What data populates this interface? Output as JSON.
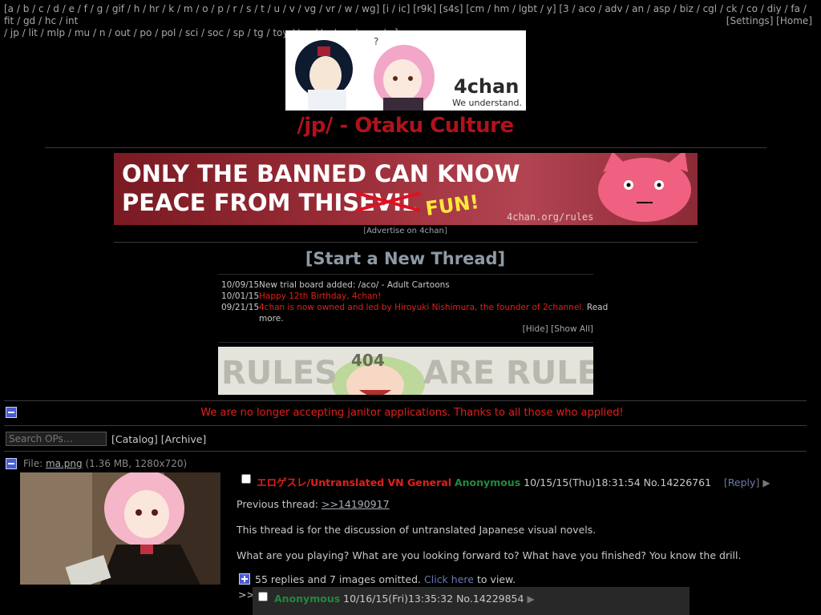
{
  "nav": {
    "left_line1": [
      "[a",
      "b",
      "c",
      "d",
      "e",
      "f",
      "g",
      "gif",
      "h",
      "hr",
      "k",
      "m",
      "o",
      "p",
      "r",
      "s",
      "t",
      "u",
      "v",
      "vg",
      "vr",
      "w",
      "wg] [i",
      "ic] [r9k] [s4s] [cm",
      "hm",
      "lgbt",
      "y] [3",
      "aco",
      "adv",
      "an",
      "asp",
      "biz",
      "cgl",
      "ck",
      "co",
      "diy",
      "fa",
      "fit",
      "gd",
      "hc",
      "int"
    ],
    "left_line2": [
      "jp",
      "lit",
      "mlp",
      "mu",
      "n",
      "out",
      "po",
      "pol",
      "sci",
      "soc",
      "sp",
      "tg",
      "toy",
      "trv",
      "tv",
      "vp",
      "wsg",
      "x]"
    ],
    "line2_prefix": "/",
    "settings": "Settings",
    "home": "Home"
  },
  "banner": {
    "logo_text": "4chan",
    "logo_sub": "We understand.",
    "question": "?"
  },
  "board_title": "/jp/ - Otaku Culture",
  "ad": {
    "line1": "ONLY THE BANNED CAN KNOW",
    "line2": "PEACE FROM THIS",
    "struck": "EVIL",
    "fun": "FUN!",
    "url": "4chan.org/rules",
    "link_text": "Advertise on 4chan"
  },
  "start_thread": "[Start a New Thread]",
  "news": [
    {
      "date": "10/09/15",
      "text": "New trial board added: /aco/ - Adult Cartoons",
      "color": "#c8c8c8"
    },
    {
      "date": "10/01/15",
      "text": "Happy 12th Birthday, 4chan!",
      "color": "#e0201a"
    },
    {
      "date": "09/21/15",
      "text": "4chan is now owned and led by Hiroyuki Nishimura, the founder of 2channel.",
      "suffix": " Read",
      "line2": "more.",
      "color": "#e0201a"
    }
  ],
  "news_controls": {
    "hide": "Hide",
    "show_all": "Show All"
  },
  "rules_banner": {
    "left": "RULES",
    "right": "ARE RULES",
    "badge": "404"
  },
  "global_message": "We are no longer accepting janitor applications. Thanks to all those who applied!",
  "search": {
    "placeholder": "Search OPs…"
  },
  "catalog_label": "Catalog",
  "archive_label": "Archive",
  "op": {
    "file_label": "File:",
    "file_name": "ma.png",
    "file_meta": "(1.36 MB, 1280x720)",
    "subject": "エロゲスレ/Untranslated VN General",
    "name": "Anonymous",
    "datetime": "10/15/15(Thu)18:31:54",
    "post_no": "No.14226761",
    "reply_label": "Reply",
    "lines": {
      "prev_label": "Previous thread: ",
      "prev_link": ">>14190917",
      "line2": "This thread is for the discussion of untranslated Japanese visual novels.",
      "line3": "What are you playing? What are you looking forward to? What have you finished? You know the drill."
    },
    "omitted_text": "55 replies and 7 images omitted.",
    "click_here": "Click here",
    "to_view": "to view."
  },
  "reply": {
    "prefix": ">>",
    "name": "Anonymous",
    "datetime": "10/16/15(Fri)13:35:32",
    "post_no": "No.14229854"
  },
  "colors": {
    "title_red": "#b0121c",
    "alert_red": "#e0201a",
    "name_green": "#1f8a3d",
    "link_grey": "#a0a6ad",
    "bg": "#000000",
    "reply_bg": "#282828"
  }
}
